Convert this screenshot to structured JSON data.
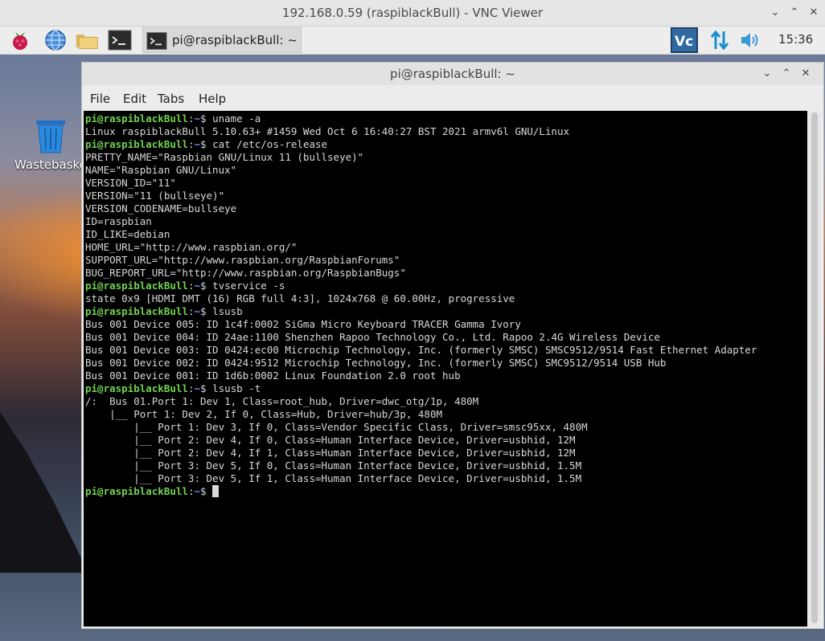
{
  "vnc": {
    "title": "192.168.0.59 (raspiblackBull) - VNC Viewer"
  },
  "taskbar": {
    "task_label": "pi@raspiblackBull: ~",
    "clock": "15:36",
    "icons": [
      "raspberry-menu-icon",
      "web-browser-icon",
      "file-manager-icon",
      "terminal-icon",
      "vnc-server-icon",
      "network-icon",
      "volume-icon"
    ]
  },
  "desktop": {
    "trash_label": "Wastebasket"
  },
  "terminal_window": {
    "title": "pi@raspiblackBull: ~",
    "menu": [
      "File",
      "Edit",
      "Tabs",
      "Help"
    ]
  },
  "terminal": {
    "prompt_user": "pi@raspiblackBull",
    "prompt_path": "~",
    "lines": [
      {
        "type": "cmd",
        "text": "uname -a"
      },
      {
        "type": "out",
        "text": "Linux raspiblackBull 5.10.63+ #1459 Wed Oct 6 16:40:27 BST 2021 armv6l GNU/Linux"
      },
      {
        "type": "cmd",
        "text": "cat /etc/os-release"
      },
      {
        "type": "out",
        "text": "PRETTY_NAME=\"Raspbian GNU/Linux 11 (bullseye)\""
      },
      {
        "type": "out",
        "text": "NAME=\"Raspbian GNU/Linux\""
      },
      {
        "type": "out",
        "text": "VERSION_ID=\"11\""
      },
      {
        "type": "out",
        "text": "VERSION=\"11 (bullseye)\""
      },
      {
        "type": "out",
        "text": "VERSION_CODENAME=bullseye"
      },
      {
        "type": "out",
        "text": "ID=raspbian"
      },
      {
        "type": "out",
        "text": "ID_LIKE=debian"
      },
      {
        "type": "out",
        "text": "HOME_URL=\"http://www.raspbian.org/\""
      },
      {
        "type": "out",
        "text": "SUPPORT_URL=\"http://www.raspbian.org/RaspbianForums\""
      },
      {
        "type": "out",
        "text": "BUG_REPORT_URL=\"http://www.raspbian.org/RaspbianBugs\""
      },
      {
        "type": "cmd",
        "text": "tvservice -s"
      },
      {
        "type": "out",
        "text": "state 0x9 [HDMI DMT (16) RGB full 4:3], 1024x768 @ 60.00Hz, progressive"
      },
      {
        "type": "cmd",
        "text": "lsusb"
      },
      {
        "type": "out",
        "text": "Bus 001 Device 005: ID 1c4f:0002 SiGma Micro Keyboard TRACER Gamma Ivory"
      },
      {
        "type": "out",
        "text": "Bus 001 Device 004: ID 24ae:1100 Shenzhen Rapoo Technology Co., Ltd. Rapoo 2.4G Wireless Device"
      },
      {
        "type": "out",
        "text": "Bus 001 Device 003: ID 0424:ec00 Microchip Technology, Inc. (formerly SMSC) SMSC9512/9514 Fast Ethernet Adapter"
      },
      {
        "type": "out",
        "text": "Bus 001 Device 002: ID 0424:9512 Microchip Technology, Inc. (formerly SMSC) SMC9512/9514 USB Hub"
      },
      {
        "type": "out",
        "text": "Bus 001 Device 001: ID 1d6b:0002 Linux Foundation 2.0 root hub"
      },
      {
        "type": "cmd",
        "text": "lsusb -t"
      },
      {
        "type": "out",
        "text": "/:  Bus 01.Port 1: Dev 1, Class=root_hub, Driver=dwc_otg/1p, 480M"
      },
      {
        "type": "out",
        "text": "    |__ Port 1: Dev 2, If 0, Class=Hub, Driver=hub/3p, 480M"
      },
      {
        "type": "out",
        "text": "        |__ Port 1: Dev 3, If 0, Class=Vendor Specific Class, Driver=smsc95xx, 480M"
      },
      {
        "type": "out",
        "text": "        |__ Port 2: Dev 4, If 0, Class=Human Interface Device, Driver=usbhid, 12M"
      },
      {
        "type": "out",
        "text": "        |__ Port 2: Dev 4, If 1, Class=Human Interface Device, Driver=usbhid, 12M"
      },
      {
        "type": "out",
        "text": "        |__ Port 3: Dev 5, If 0, Class=Human Interface Device, Driver=usbhid, 1.5M"
      },
      {
        "type": "out",
        "text": "        |__ Port 3: Dev 5, If 1, Class=Human Interface Device, Driver=usbhid, 1.5M"
      },
      {
        "type": "prompt",
        "text": ""
      }
    ]
  },
  "colors": {
    "prompt_user": "#6fd24f",
    "prompt_path": "#6b8cff",
    "terminal_bg": "#000000",
    "terminal_fg": "#d8d8d8"
  }
}
